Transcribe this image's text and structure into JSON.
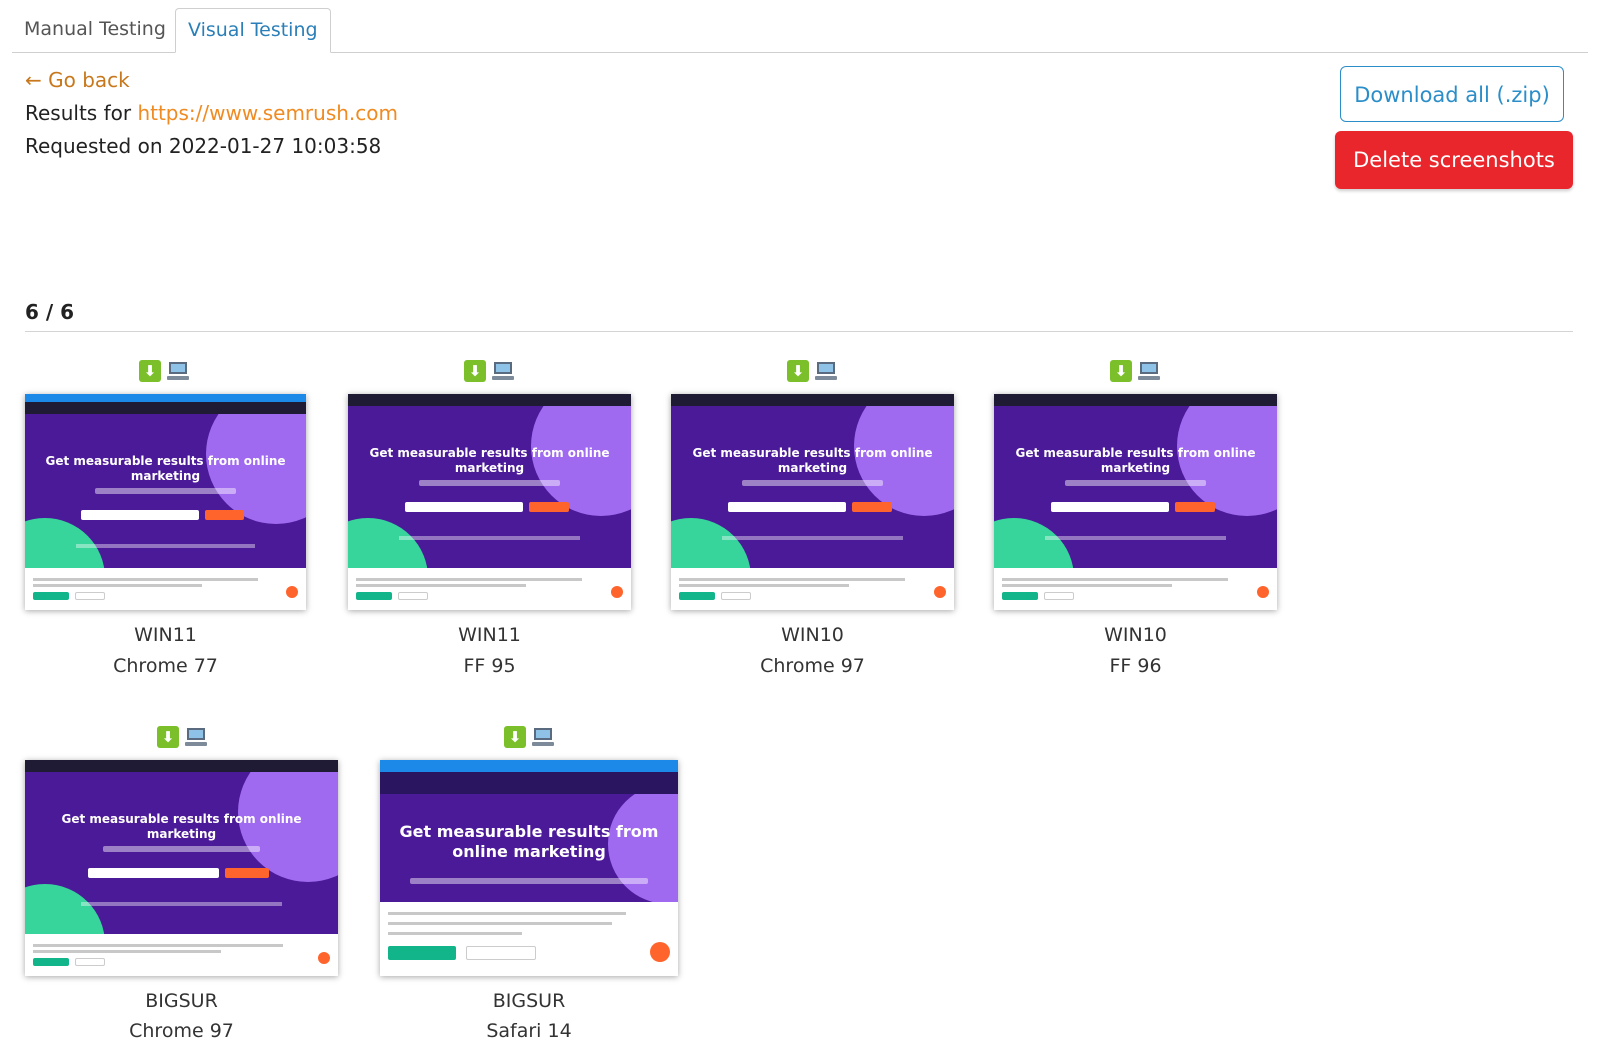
{
  "tabs": [
    {
      "label": "Manual Testing",
      "active": false
    },
    {
      "label": "Visual Testing",
      "active": true
    }
  ],
  "header": {
    "go_back": "← Go back",
    "results_prefix": "Results for",
    "url": "https://www.semrush.com",
    "requested": "Requested on 2022-01-27 10:03:58"
  },
  "buttons": {
    "download_all": "Download all (.zip)",
    "delete": "Delete screenshots"
  },
  "count": "6 / 6",
  "shots": [
    {
      "os": "WIN11",
      "browser": "Chrome 77",
      "headline": "Get measurable results from online marketing"
    },
    {
      "os": "WIN11",
      "browser": "FF 95",
      "headline": "Get measurable results from online marketing"
    },
    {
      "os": "WIN10",
      "browser": "Chrome 97",
      "headline": "Get measurable results from online marketing"
    },
    {
      "os": "WIN10",
      "browser": "FF 96",
      "headline": "Get measurable results from online marketing"
    },
    {
      "os": "BIGSUR",
      "browser": "Chrome 97",
      "headline": "Get measurable results from online marketing"
    },
    {
      "os": "BIGSUR",
      "browser": "Safari 14",
      "headline": "Get measurable results from online marketing"
    }
  ],
  "icons": {
    "download": "download-icon",
    "device": "computer-icon"
  },
  "colors": {
    "accent": "#2b8ec9",
    "danger": "#e8262c",
    "link": "#ef8b22",
    "hero": "#4b1a98"
  }
}
